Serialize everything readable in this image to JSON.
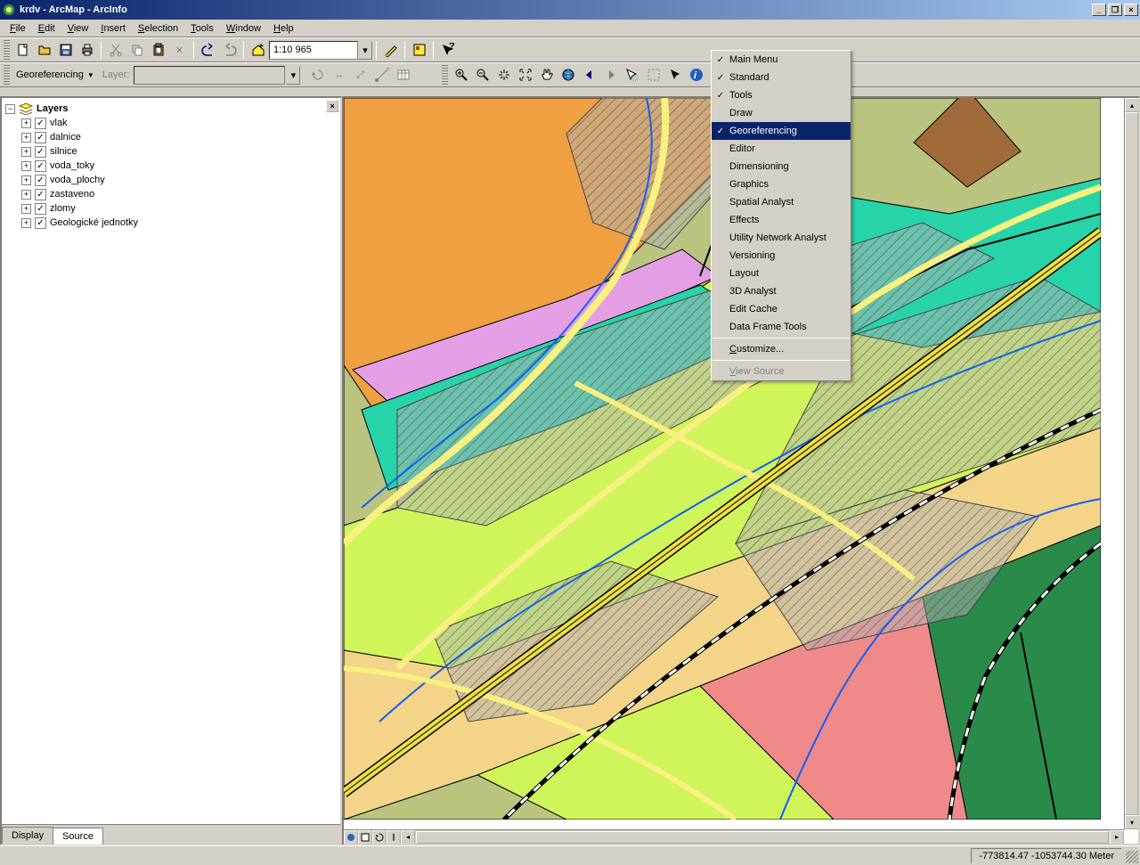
{
  "window": {
    "title": "krdv - ArcMap - ArcInfo"
  },
  "menubar": {
    "items": [
      "File",
      "Edit",
      "View",
      "Insert",
      "Selection",
      "Tools",
      "Window",
      "Help"
    ]
  },
  "toolbar_std": {
    "scale": "1:10 965"
  },
  "georef_bar": {
    "label": "Georeferencing",
    "layer_label": "Layer:"
  },
  "toc": {
    "root": "Layers",
    "layers": [
      {
        "name": "vlak",
        "checked": true
      },
      {
        "name": "dalnice",
        "checked": true
      },
      {
        "name": "silnice",
        "checked": true
      },
      {
        "name": "voda_toky",
        "checked": true
      },
      {
        "name": "voda_plochy",
        "checked": true
      },
      {
        "name": "zastaveno",
        "checked": true
      },
      {
        "name": "zlomy",
        "checked": true
      },
      {
        "name": "Geologické jednotky",
        "checked": true
      }
    ],
    "tab_display": "Display",
    "tab_source": "Source"
  },
  "context_menu": {
    "items": [
      {
        "label": "Main Menu",
        "checked": true
      },
      {
        "label": "Standard",
        "checked": true
      },
      {
        "label": "Tools",
        "checked": true
      },
      {
        "label": "Draw",
        "checked": false
      },
      {
        "label": "Georeferencing",
        "checked": true,
        "highlighted": true
      },
      {
        "label": "Editor",
        "checked": false
      },
      {
        "label": "Dimensioning",
        "checked": false
      },
      {
        "label": "Graphics",
        "checked": false
      },
      {
        "label": "Spatial Analyst",
        "checked": false
      },
      {
        "label": "Effects",
        "checked": false
      },
      {
        "label": "Utility Network Analyst",
        "checked": false
      },
      {
        "label": "Versioning",
        "checked": false
      },
      {
        "label": "Layout",
        "checked": false
      },
      {
        "label": "3D Analyst",
        "checked": false
      },
      {
        "label": "Edit Cache",
        "checked": false
      },
      {
        "label": "Data Frame Tools",
        "checked": false
      }
    ],
    "customize": "Customize...",
    "view_source": "View Source"
  },
  "statusbar": {
    "coords": "-773814.47  -1053744.30 Meter"
  }
}
